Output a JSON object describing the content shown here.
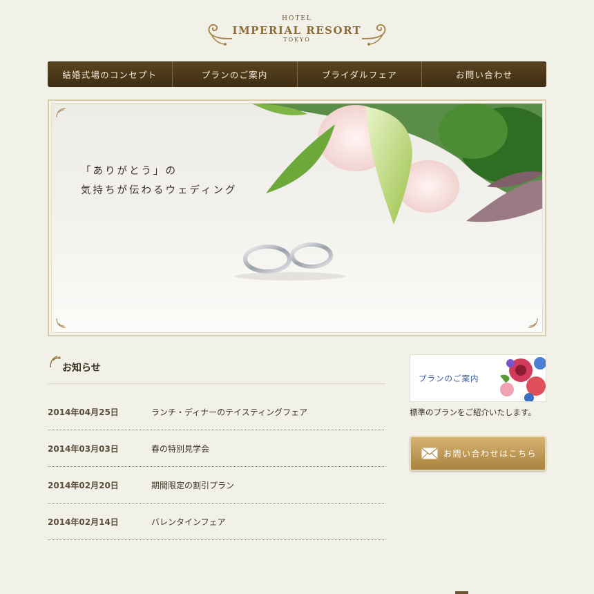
{
  "header": {
    "hotel": "HOTEL",
    "name": "IMPERIAL RESORT",
    "city": "TOKYO"
  },
  "nav": {
    "items": [
      {
        "label": "結婚式場のコンセプト"
      },
      {
        "label": "プランのご案内"
      },
      {
        "label": "ブライダルフェア"
      },
      {
        "label": "お問い合わせ"
      }
    ]
  },
  "hero": {
    "line1": "「ありがとう」の",
    "line2": "気持ちが伝わるウェディング"
  },
  "news": {
    "heading": "お知らせ",
    "items": [
      {
        "date": "2014年04月25日",
        "title": "ランチ・ディナーのテイスティングフェア"
      },
      {
        "date": "2014年03月03日",
        "title": "春の特別見学会"
      },
      {
        "date": "2014年02月20日",
        "title": "期間限定の割引プラン"
      },
      {
        "date": "2014年02月14日",
        "title": "バレンタインフェア"
      }
    ]
  },
  "sidebar": {
    "plan_banner_label": "プランのご案内",
    "plan_description": "標準のプランをご紹介いたします。",
    "contact_label": "お問い合わせはこちら"
  },
  "colors": {
    "page_bg": "#f2f1e8",
    "nav_bg": "#4a3618",
    "accent_gold": "#a9854a",
    "text_dark": "#3b2f21"
  }
}
